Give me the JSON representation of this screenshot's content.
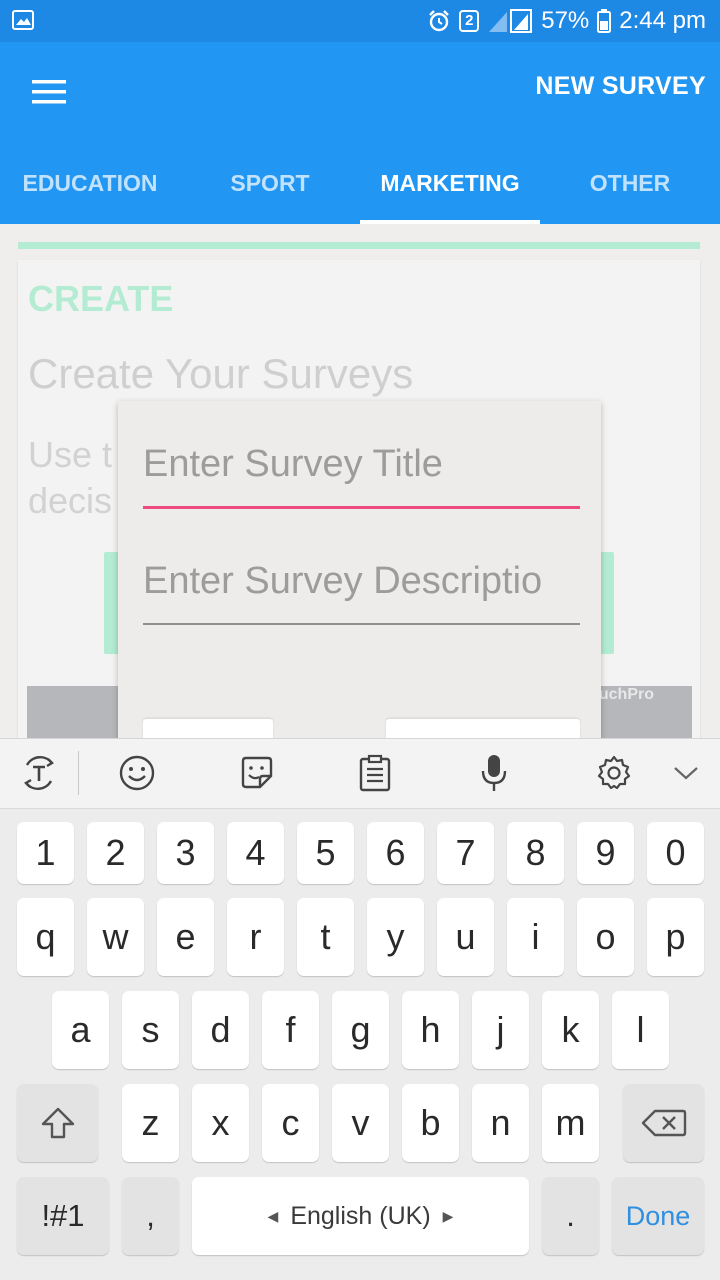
{
  "status_bar": {
    "notification_badge": "2",
    "battery": "57%",
    "time": "2:44 pm"
  },
  "app_bar": {
    "action": "NEW SURVEY",
    "tabs": [
      {
        "label": "EDUCATION",
        "active": false
      },
      {
        "label": "SPORT",
        "active": false
      },
      {
        "label": "MARKETING",
        "active": true
      },
      {
        "label": "OTHER",
        "active": false
      }
    ]
  },
  "card": {
    "label": "CREATE",
    "heading": "Create Your Surveys",
    "body_line1": "Use t",
    "body_line2": "decis",
    "image_watermark": "uchPro"
  },
  "dialog": {
    "title_placeholder": "Enter Survey Title",
    "description_placeholder": "Enter Survey Descriptio"
  },
  "keyboard": {
    "toolbar_icons": [
      "text-mode-icon",
      "emoji-icon",
      "sticker-icon",
      "clipboard-icon",
      "microphone-icon",
      "settings-icon",
      "chevron-down-icon"
    ],
    "row_numbers": [
      "1",
      "2",
      "3",
      "4",
      "5",
      "6",
      "7",
      "8",
      "9",
      "0"
    ],
    "row_top": [
      "q",
      "w",
      "e",
      "r",
      "t",
      "y",
      "u",
      "i",
      "o",
      "p"
    ],
    "row_middle": [
      "a",
      "s",
      "d",
      "f",
      "g",
      "h",
      "j",
      "k",
      "l"
    ],
    "row_bottom": [
      "z",
      "x",
      "c",
      "v",
      "b",
      "n",
      "m"
    ],
    "symbols_key": "!#1",
    "comma_key": ",",
    "space_label": "English (UK)",
    "period_key": ".",
    "done_key": "Done"
  },
  "colors": {
    "status_bar": "#1e88e5",
    "app_bar": "#2196f3",
    "accent_pink": "#ef4a7f",
    "mint": "#b3ecd3",
    "done_blue": "#2f8fe0"
  }
}
